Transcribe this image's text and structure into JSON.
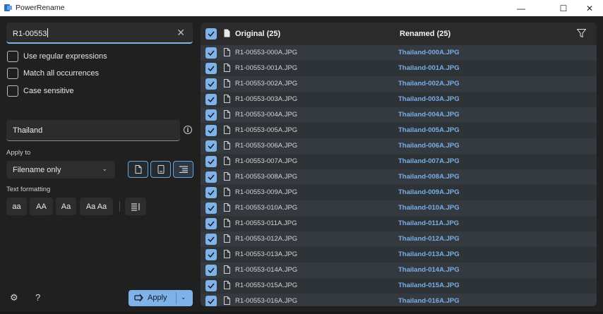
{
  "window": {
    "title": "PowerRename",
    "minimize_glyph": "—",
    "maximize_glyph": "☐",
    "close_glyph": "✕"
  },
  "search": {
    "value": "R1-00553",
    "clear_glyph": "✕"
  },
  "options": [
    {
      "label": "Use regular expressions",
      "checked": false
    },
    {
      "label": "Match all occurrences",
      "checked": false
    },
    {
      "label": "Case sensitive",
      "checked": false
    }
  ],
  "replace": {
    "value": "Thailand",
    "info_glyph": "i"
  },
  "apply_to": {
    "label": "Apply to",
    "selected": "Filename only",
    "chevron": "⌄",
    "toggles": [
      {
        "icon": "file-icon",
        "active": false
      },
      {
        "icon": "document-icon",
        "active": false
      },
      {
        "icon": "align-right-icon",
        "active": true
      }
    ]
  },
  "text_formatting": {
    "label": "Text formatting",
    "buttons": [
      "aa",
      "AA",
      "Aa",
      "Aa Aa"
    ],
    "enumerate_icon": "list-numbered-icon"
  },
  "bottom": {
    "settings_glyph": "⚙",
    "help_glyph": "?",
    "apply_label": "Apply",
    "apply_chevron": "⌄"
  },
  "list": {
    "original_header": "Original (25)",
    "renamed_header": "Renamed (25)",
    "rows": [
      {
        "original": "R1-00553-000A.JPG",
        "renamed": "Thailand-000A.JPG"
      },
      {
        "original": "R1-00553-001A.JPG",
        "renamed": "Thailand-001A.JPG"
      },
      {
        "original": "R1-00553-002A.JPG",
        "renamed": "Thailand-002A.JPG"
      },
      {
        "original": "R1-00553-003A.JPG",
        "renamed": "Thailand-003A.JPG"
      },
      {
        "original": "R1-00553-004A.JPG",
        "renamed": "Thailand-004A.JPG"
      },
      {
        "original": "R1-00553-005A.JPG",
        "renamed": "Thailand-005A.JPG"
      },
      {
        "original": "R1-00553-006A.JPG",
        "renamed": "Thailand-006A.JPG"
      },
      {
        "original": "R1-00553-007A.JPG",
        "renamed": "Thailand-007A.JPG"
      },
      {
        "original": "R1-00553-008A.JPG",
        "renamed": "Thailand-008A.JPG"
      },
      {
        "original": "R1-00553-009A.JPG",
        "renamed": "Thailand-009A.JPG"
      },
      {
        "original": "R1-00553-010A.JPG",
        "renamed": "Thailand-010A.JPG"
      },
      {
        "original": "R1-00553-011A.JPG",
        "renamed": "Thailand-011A.JPG"
      },
      {
        "original": "R1-00553-012A.JPG",
        "renamed": "Thailand-012A.JPG"
      },
      {
        "original": "R1-00553-013A.JPG",
        "renamed": "Thailand-013A.JPG"
      },
      {
        "original": "R1-00553-014A.JPG",
        "renamed": "Thailand-014A.JPG"
      },
      {
        "original": "R1-00553-015A.JPG",
        "renamed": "Thailand-015A.JPG"
      },
      {
        "original": "R1-00553-016A.JPG",
        "renamed": "Thailand-016A.JPG"
      }
    ]
  },
  "colors": {
    "accent": "#7fb2e8",
    "renamed_text": "#79aee6",
    "background": "#202020",
    "panel": "#2b2b2b"
  }
}
